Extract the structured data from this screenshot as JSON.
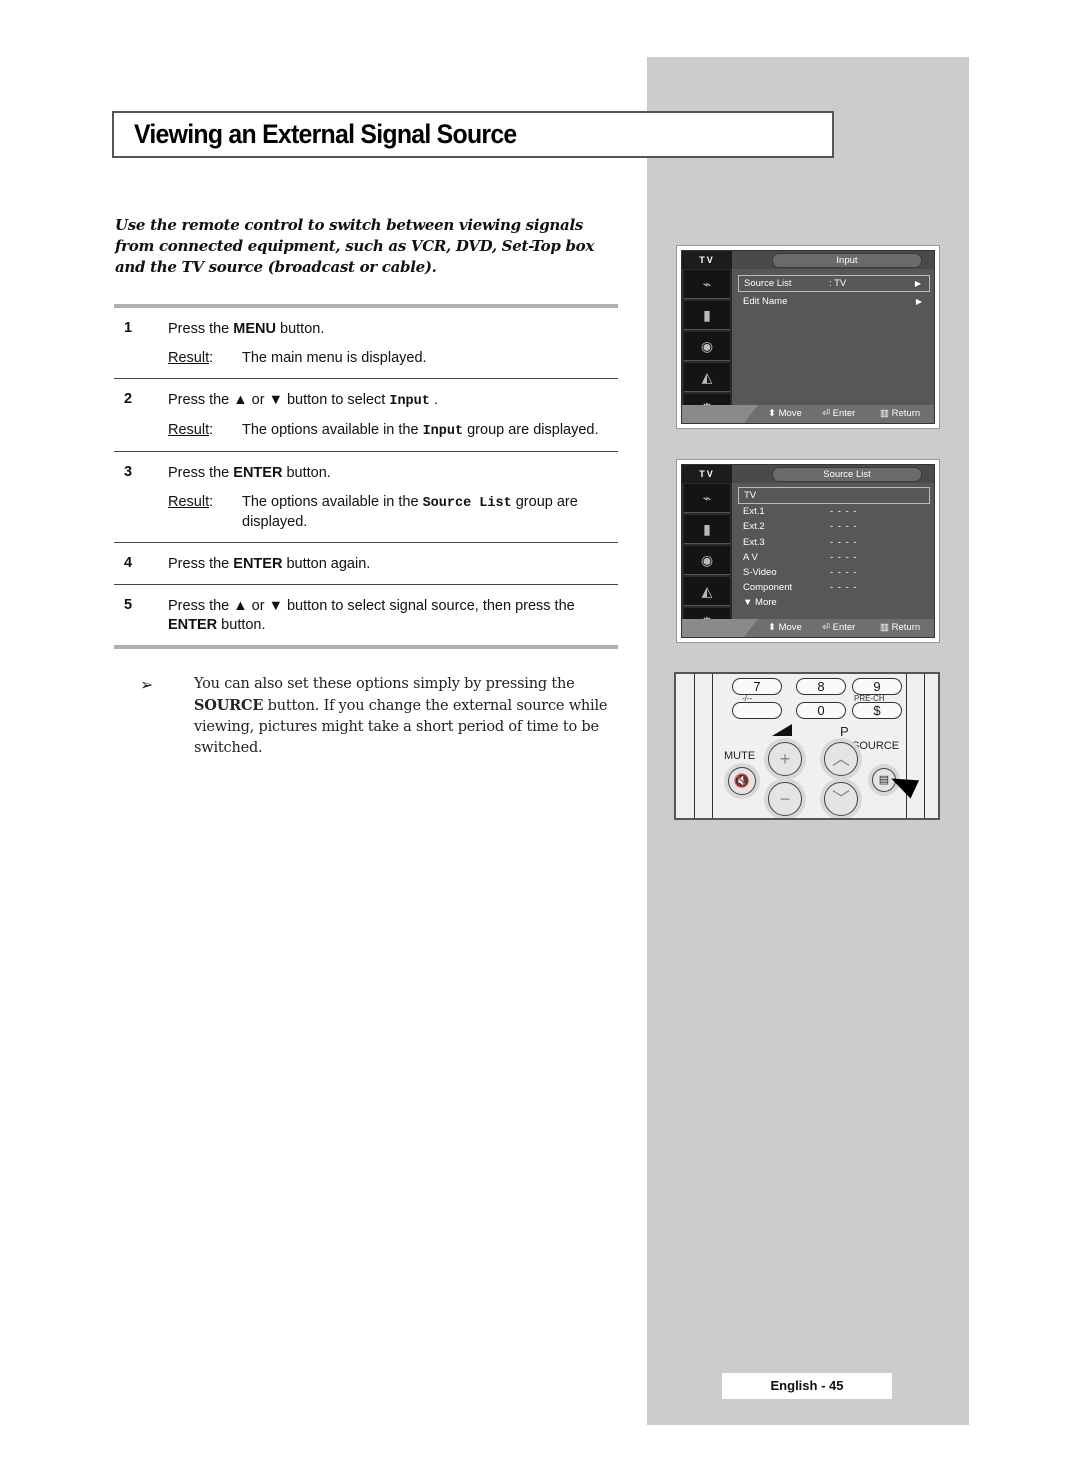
{
  "page": {
    "title": "Viewing an External Signal Source",
    "intro": "Use the remote control to switch between viewing signals from connected equipment, such as VCR, DVD, Set-Top box and the TV source (broadcast or cable).",
    "result_label": "Result",
    "steps": [
      {
        "num": "1",
        "pre": "Press the ",
        "bold": "MENU",
        "post": " button.",
        "result": "The main menu is displayed."
      },
      {
        "num": "2",
        "pre": "Press the ▲ or ▼ button to select ",
        "mono": "Input",
        "post": " .",
        "result_pre": "The options available in the ",
        "result_mono": "Input",
        "result_post": " group are displayed."
      },
      {
        "num": "3",
        "pre": "Press the ",
        "bold": "ENTER",
        "post": " button.",
        "result_pre": "The options available in the ",
        "result_mono": "Source List",
        "result_post": " group are displayed."
      },
      {
        "num": "4",
        "pre": "Press the ",
        "bold": "ENTER",
        "post": " button again."
      },
      {
        "num": "5",
        "pre": "Press the ▲ or ▼ button to select signal source, then press the ",
        "bold": "ENTER",
        "post": " button."
      }
    ],
    "note": {
      "arrow": "➢",
      "pre": "You can also set these options simply by pressing the ",
      "bold": "SOURCE",
      "post": " button. If you change the external source while viewing, pictures might take a short period of time to be switched."
    },
    "footer": "English - 45"
  },
  "osd_input": {
    "tv_label": "TV",
    "header": "Input",
    "icons": [
      "antenna-plug-icon",
      "picture-icon",
      "sound-icon",
      "channel-icon",
      "setup-icon"
    ],
    "rows": [
      {
        "label": "Source List",
        "value": ": TV",
        "arrow": "▶",
        "selected": true
      },
      {
        "label": "Edit Name",
        "value": "",
        "arrow": "▶",
        "selected": false
      }
    ],
    "footer": {
      "move": "Move",
      "enter": "Enter",
      "return": "Return"
    }
  },
  "osd_source": {
    "tv_label": "TV",
    "header": "Source List",
    "rows": [
      {
        "label": "TV",
        "value": "",
        "selected": true
      },
      {
        "label": "Ext.1",
        "value": "- - - -"
      },
      {
        "label": "Ext.2",
        "value": "- - - -"
      },
      {
        "label": "Ext.3",
        "value": "- - - -"
      },
      {
        "label": "A V",
        "value": "- - - -"
      },
      {
        "label": "S-Video",
        "value": "- - - -"
      },
      {
        "label": "Component",
        "value": "- - - -"
      },
      {
        "label": "▼  More",
        "value": ""
      }
    ],
    "footer": {
      "move": "Move",
      "enter": "Enter",
      "return": "Return"
    }
  },
  "remote": {
    "buttons": {
      "b7": "7",
      "b8": "8",
      "b9": "9",
      "b0": "0"
    },
    "sub_labels": {
      "dash": "-/--",
      "prech": "PRE-CH"
    },
    "labels": {
      "mute": "MUTE",
      "p": "P",
      "source": "SOURCE"
    }
  }
}
